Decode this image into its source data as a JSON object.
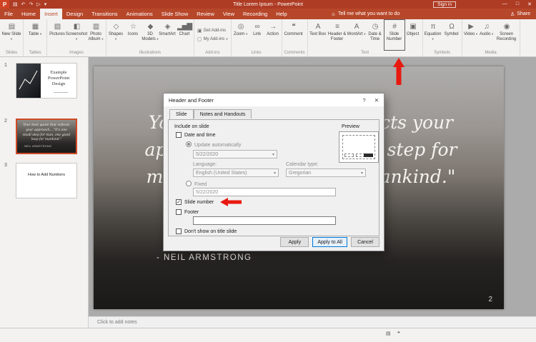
{
  "annotations": {
    "arrow_color": "#E8190F"
  },
  "window": {
    "title": "Title Lorem Ipsum  -  PowerPoint",
    "sign_in_label": "Sign in",
    "qat": {
      "logo_glyph": "P",
      "save_glyph": "▤",
      "undo_glyph": "↶",
      "redo_glyph": "↷",
      "present_glyph": "▷",
      "more_glyph": "▾"
    },
    "controls": {
      "minimize": "—",
      "maximize": "□",
      "close": "✕"
    }
  },
  "menu": {
    "tabs": [
      "File",
      "Home",
      "Insert",
      "Design",
      "Transitions",
      "Animations",
      "Slide Show",
      "Review",
      "View",
      "Recording",
      "Help"
    ],
    "tell_me": {
      "icon": "☼",
      "label": "Tell me what you want to do"
    },
    "share": {
      "icon": "♙",
      "label": "Share"
    }
  },
  "ribbon": {
    "groups": [
      {
        "label": "Slides",
        "buttons": [
          {
            "label": "New Slide",
            "icon": "▤",
            "arrow": "▾"
          }
        ]
      },
      {
        "label": "Tables",
        "buttons": [
          {
            "label": "Table",
            "icon": "▦",
            "arrow": "▾"
          }
        ]
      },
      {
        "label": "Images",
        "buttons": [
          {
            "label": "Pictures",
            "icon": "▨"
          },
          {
            "label": "Screenshot",
            "icon": "◧",
            "arrow": "▾"
          },
          {
            "label": "Photo Album",
            "icon": "▥",
            "arrow": "▾"
          }
        ]
      },
      {
        "label": "Illustrations",
        "buttons": [
          {
            "label": "Shapes",
            "icon": "◇",
            "arrow": "▾"
          },
          {
            "label": "Icons",
            "icon": "☆"
          },
          {
            "label": "3D Models",
            "icon": "◆",
            "arrow": "▾"
          },
          {
            "label": "SmartArt",
            "icon": "◈"
          },
          {
            "label": "Chart",
            "icon": "▂▅▇"
          }
        ]
      },
      {
        "label": "Add-ins",
        "buttons": [
          {
            "label": "Get Add-ins",
            "icon": "▣"
          },
          {
            "label": "My Add-ins",
            "icon": "▢",
            "arrow": "▾"
          }
        ]
      },
      {
        "label": "Links",
        "buttons": [
          {
            "label": "Zoom",
            "icon": "◎",
            "arrow": "▾"
          },
          {
            "label": "Link",
            "icon": "∞"
          },
          {
            "label": "Action",
            "icon": "→"
          }
        ]
      },
      {
        "label": "Comments",
        "buttons": [
          {
            "label": "Comment",
            "icon": "❝"
          }
        ]
      },
      {
        "label": "Text",
        "buttons": [
          {
            "label": "Text Box",
            "icon": "A"
          },
          {
            "label": "Header & Footer",
            "icon": "≡"
          },
          {
            "label": "WordArt",
            "icon": "A",
            "arrow": "▾"
          },
          {
            "label": "Date & Time",
            "icon": "◷"
          },
          {
            "label": "Slide Number",
            "icon": "#"
          },
          {
            "label": "Object",
            "icon": "▣"
          }
        ]
      },
      {
        "label": "Symbols",
        "buttons": [
          {
            "label": "Equation",
            "icon": "π",
            "arrow": "▾"
          },
          {
            "label": "Symbol",
            "icon": "Ω"
          }
        ]
      },
      {
        "label": "Media",
        "buttons": [
          {
            "label": "Video",
            "icon": "▶",
            "arrow": "▾"
          },
          {
            "label": "Audio",
            "icon": "♫",
            "arrow": "▾"
          },
          {
            "label": "Screen Recording",
            "icon": "◉"
          }
        ]
      }
    ]
  },
  "slide_panel": {
    "thumbnails": [
      {
        "number": "1",
        "title": "Example PowerPoint Design"
      },
      {
        "number": "2",
        "quote": "Your best quote that reflects your approach... \"It's one small step for man, one giant leap for mankind.\"",
        "attribution": "- NEIL ARMSTRONG"
      },
      {
        "number": "3",
        "title": "How to Add Numbers"
      }
    ]
  },
  "slide": {
    "quote_line1": "Your best quote that reflects your",
    "quote_line2": "approach... \"It's one small step for",
    "quote_line3": "man, one giant leap for mankind.\"",
    "attribution": "- NEIL ARMSTRONG",
    "number": "2"
  },
  "dialog": {
    "title": "Header and Footer",
    "help_glyph": "?",
    "close_glyph": "✕",
    "tabs": [
      "Slide",
      "Notes and Handouts"
    ],
    "include_label": "Include on slide",
    "date_time": "Date and time",
    "update_auto": "Update automatically",
    "date_value": "5/22/2020",
    "combo_arrow": "▾",
    "language_label": "Language:",
    "language_value": "English (United States)",
    "calendar_label": "Calendar type:",
    "calendar_value": "Gregorian",
    "fixed_label": "Fixed",
    "fixed_value": "5/22/2020",
    "slide_number": "Slide number",
    "footer": "Footer",
    "footer_value": "",
    "dont_show": "Don't show on title slide",
    "preview_label": "Preview",
    "check_glyph": "✓",
    "apply": "Apply",
    "apply_all": "Apply to All",
    "cancel": "Cancel"
  },
  "notes": {
    "placeholder": "Click to add notes"
  },
  "statusbar": {
    "notes_glyph": "▤",
    "comments_glyph": "❝"
  }
}
